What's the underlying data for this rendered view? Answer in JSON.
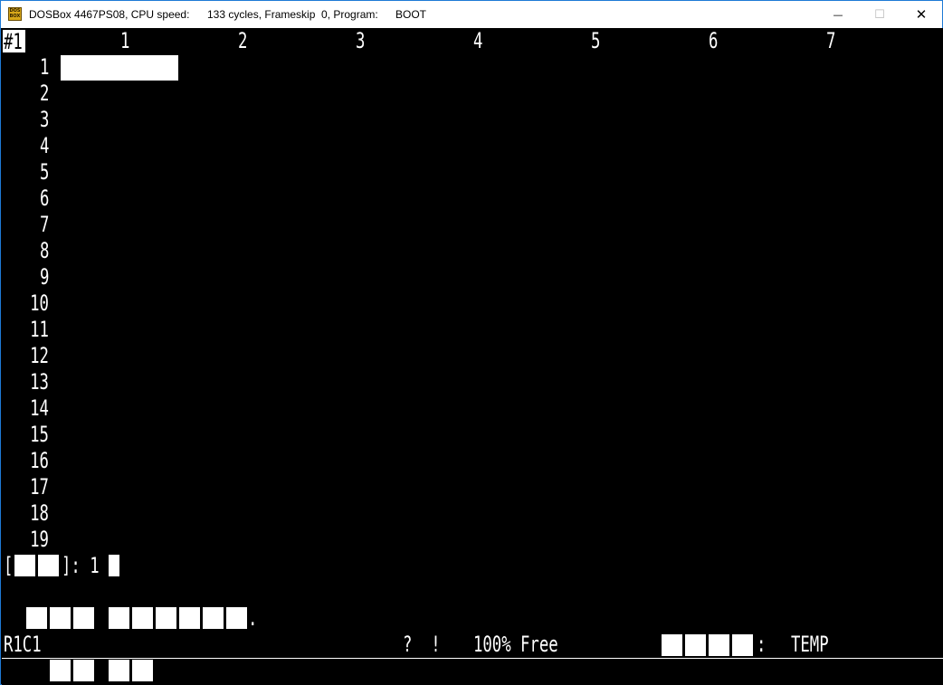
{
  "window": {
    "title": "DOSBox 4467PS08, CPU speed:",
    "cycles": "133 cycles, Frameskip  0, Program:",
    "program": "BOOT",
    "icon": "dosbox-icon",
    "icon_text": "DOS BOX",
    "controls": {
      "minimize": "—",
      "maximize": "☐",
      "close": "✕"
    }
  },
  "sheet": {
    "tag": "#1",
    "columns": [
      "1",
      "2",
      "3",
      "4",
      "5",
      "6",
      "7"
    ],
    "rows": [
      "1",
      "2",
      "3",
      "4",
      "5",
      "6",
      "7",
      "8",
      "9",
      "10",
      "11",
      "12",
      "13",
      "14",
      "15",
      "16",
      "17",
      "18",
      "19"
    ],
    "active_cell": "R1C1"
  },
  "prompt": {
    "open_bracket": "[",
    "close_bracket": "]: 1"
  },
  "message": {
    "trailing": "."
  },
  "status": {
    "cell_ref": "R1C1",
    "flags": "?  !",
    "free": "100% Free",
    "file_sep": ":",
    "file_name": "TEMP"
  },
  "colors": {
    "background": "#000000",
    "text": "#ffffff",
    "title_bar": "#ffffff",
    "window_border": "#1e7ad6"
  }
}
